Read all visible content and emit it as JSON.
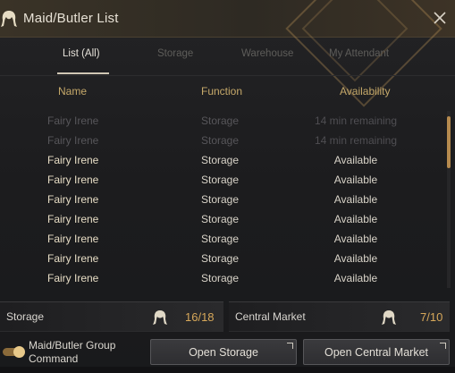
{
  "window": {
    "title": "Maid/Butler List"
  },
  "tabs": [
    {
      "label": "List (All)",
      "active": true
    },
    {
      "label": "Storage",
      "active": false
    },
    {
      "label": "Warehouse",
      "active": false
    },
    {
      "label": "My Attendant",
      "active": false
    }
  ],
  "columns": {
    "name": "Name",
    "function": "Function",
    "availability": "Availability"
  },
  "rows": [
    {
      "name": "Fairy Irene",
      "function": "Storage",
      "availability": "14 min remaining",
      "available": false
    },
    {
      "name": "Fairy Irene",
      "function": "Storage",
      "availability": "14 min remaining",
      "available": false
    },
    {
      "name": "Fairy Irene",
      "function": "Storage",
      "availability": "Available",
      "available": true
    },
    {
      "name": "Fairy Irene",
      "function": "Storage",
      "availability": "Available",
      "available": true
    },
    {
      "name": "Fairy Irene",
      "function": "Storage",
      "availability": "Available",
      "available": true
    },
    {
      "name": "Fairy Irene",
      "function": "Storage",
      "availability": "Available",
      "available": true
    },
    {
      "name": "Fairy Irene",
      "function": "Storage",
      "availability": "Available",
      "available": true
    },
    {
      "name": "Fairy Irene",
      "function": "Storage",
      "availability": "Available",
      "available": true
    },
    {
      "name": "Fairy Irene",
      "function": "Storage",
      "availability": "Available",
      "available": true
    }
  ],
  "summary": {
    "storage": {
      "label": "Storage",
      "count": "16/18",
      "icon": "maid-icon"
    },
    "market": {
      "label": "Central Market",
      "count": "7/10",
      "icon": "maid-icon"
    }
  },
  "footer": {
    "group_command_label": "Maid/Butler Group Command",
    "group_command_on": true,
    "open_storage_label": "Open Storage",
    "open_market_label": "Open Central Market"
  },
  "colors": {
    "accent": "#c6a96a",
    "count": "#d7a85a",
    "scroll_thumb": "#b58a4e"
  }
}
